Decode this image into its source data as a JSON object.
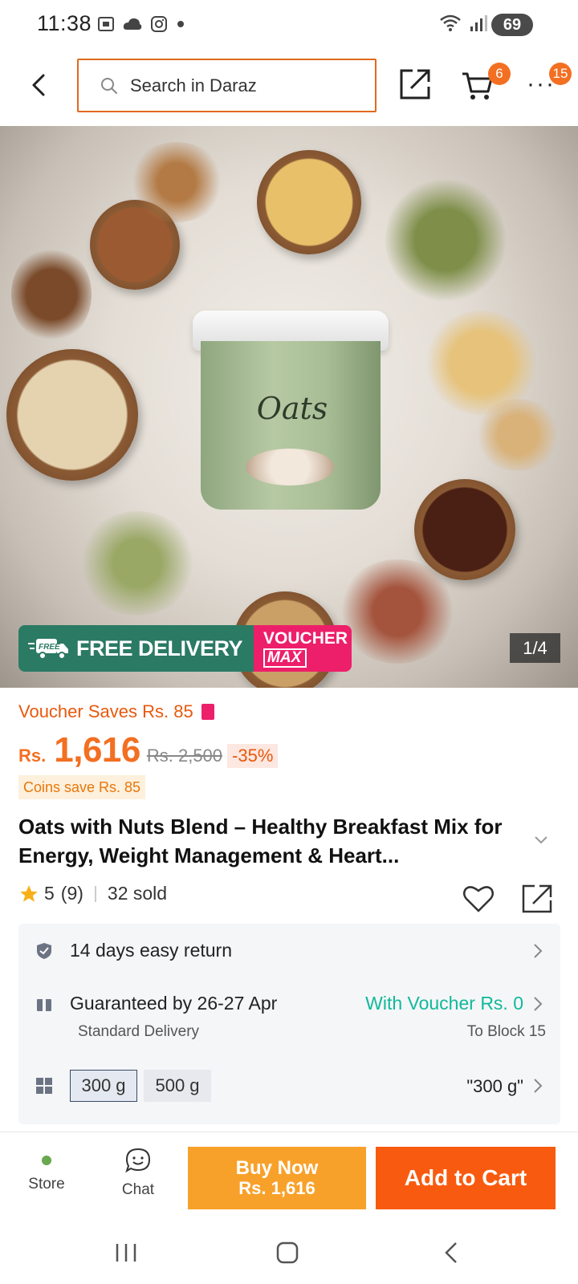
{
  "status_bar": {
    "time": "11:38",
    "battery": "69",
    "icons_left": [
      "screenshot-icon",
      "cloud-icon",
      "instagram-icon",
      "dot-icon"
    ],
    "icons_right": [
      "wifi-icon",
      "signal-icon"
    ]
  },
  "header": {
    "search_placeholder": "Search in Daraz",
    "cart_count": "6",
    "more_count": "15"
  },
  "hero": {
    "promo_free": "FREE DELIVERY",
    "promo_free_tag": "FREE",
    "promo_voucher_1": "VOUCHER",
    "promo_voucher_2": "MAX",
    "image_counter": "1/4",
    "product_label": "Oats"
  },
  "pricing": {
    "voucher_saves": "Voucher Saves Rs. 85",
    "currency": "Rs.",
    "price": "1,616",
    "old_price": "Rs. 2,500",
    "discount": "-35%",
    "coins": "Coins save Rs. 85"
  },
  "product": {
    "title": "Oats with Nuts Blend – Healthy Breakfast Mix for Energy, Weight Management & Heart...",
    "rating": "5",
    "review_count": "(9)",
    "sold": "32 sold"
  },
  "info": {
    "return": "14 days easy return",
    "delivery": "Guaranteed by 26-27 Apr",
    "delivery_type": "Standard Delivery",
    "voucher": "With Voucher Rs. 0",
    "location": "To Block 15",
    "variants": [
      "300 g",
      "500 g"
    ],
    "selected_variant": "\"300 g\""
  },
  "actions": {
    "store": "Store",
    "chat": "Chat",
    "buy_now": "Buy Now",
    "buy_price": "Rs. 1,616",
    "add_to_cart": "Add to Cart"
  },
  "colors": {
    "accent": "#f36f21",
    "search_border": "#e06a1d",
    "teal": "#11b99a",
    "buy_now": "#f8a12a",
    "add_to_cart": "#f85b0f",
    "free_delivery": "#2b7a64",
    "voucher_max": "#ed1f6a"
  }
}
